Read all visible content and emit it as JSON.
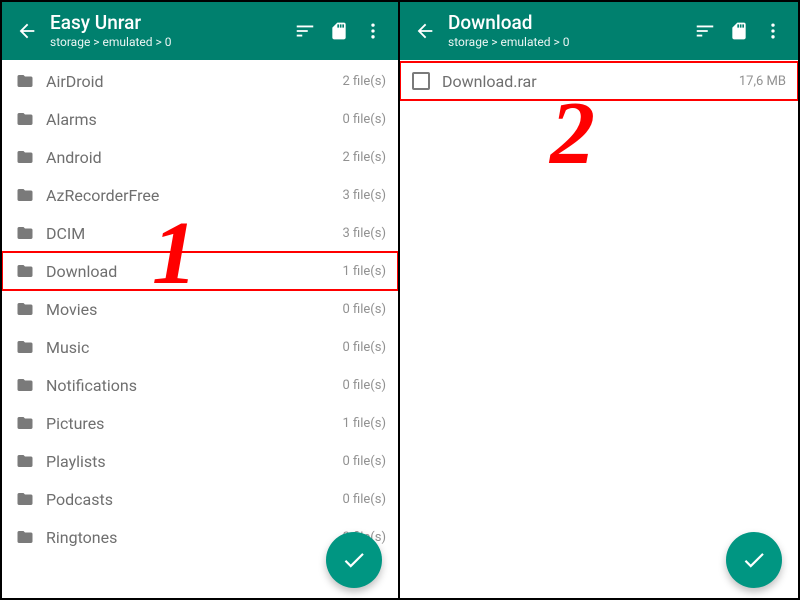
{
  "colors": {
    "brand": "#00806e",
    "fab": "#009682",
    "accent": "#ff0000"
  },
  "pane1": {
    "title": "Easy Unrar",
    "subtitle": "storage > emulated > 0",
    "annotation_number": "1",
    "highlight_index": 5,
    "items": [
      {
        "name": "AirDroid",
        "meta": "2 file(s)"
      },
      {
        "name": "Alarms",
        "meta": "0 file(s)"
      },
      {
        "name": "Android",
        "meta": "2 file(s)"
      },
      {
        "name": "AzRecorderFree",
        "meta": "3 file(s)"
      },
      {
        "name": "DCIM",
        "meta": "3 file(s)"
      },
      {
        "name": "Download",
        "meta": "1 file(s)"
      },
      {
        "name": "Movies",
        "meta": "0 file(s)"
      },
      {
        "name": "Music",
        "meta": "0 file(s)"
      },
      {
        "name": "Notifications",
        "meta": "0 file(s)"
      },
      {
        "name": "Pictures",
        "meta": "1 file(s)"
      },
      {
        "name": "Playlists",
        "meta": "0 file(s)"
      },
      {
        "name": "Podcasts",
        "meta": "0 file(s)"
      },
      {
        "name": "Ringtones",
        "meta": "0 file(s)"
      }
    ]
  },
  "pane2": {
    "title": "Download",
    "subtitle": "storage > emulated > 0",
    "annotation_number": "2",
    "highlight_index": 0,
    "items": [
      {
        "name": "Download.rar",
        "meta": "17,6 MB",
        "checkbox": true
      }
    ]
  }
}
